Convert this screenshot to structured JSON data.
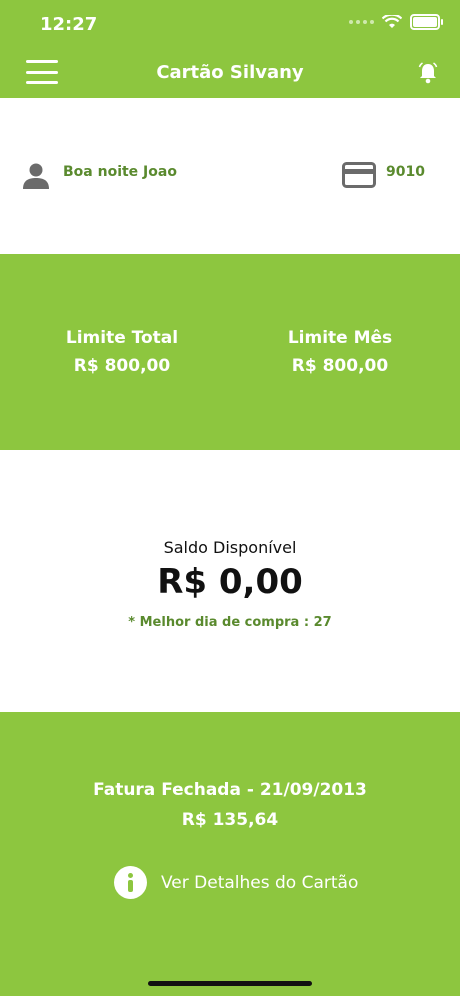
{
  "status": {
    "time": "12:27"
  },
  "header": {
    "title": "Cartão Silvany",
    "icons": [
      "menu-icon",
      "bell-icon"
    ]
  },
  "greeting": {
    "text": "Boa noite Joao",
    "card_number": "9010",
    "icons": [
      "user-icon",
      "credit-card-icon"
    ]
  },
  "limits": {
    "total_label": "Limite Total",
    "total_value": "R$ 800,00",
    "month_label": "Limite Mês",
    "month_value": "R$ 800,00"
  },
  "balance": {
    "label": "Saldo Disponível",
    "value": "R$ 0,00",
    "note": "* Melhor dia de compra : 27"
  },
  "invoice": {
    "title": "Fatura Fechada - 21/09/2013",
    "value": "R$ 135,64",
    "details_label": "Ver Detalhes do Cartão",
    "icon": "info-icon"
  },
  "colors": {
    "accent": "#8dc63f",
    "dark_green_text": "#5a8a2e"
  }
}
